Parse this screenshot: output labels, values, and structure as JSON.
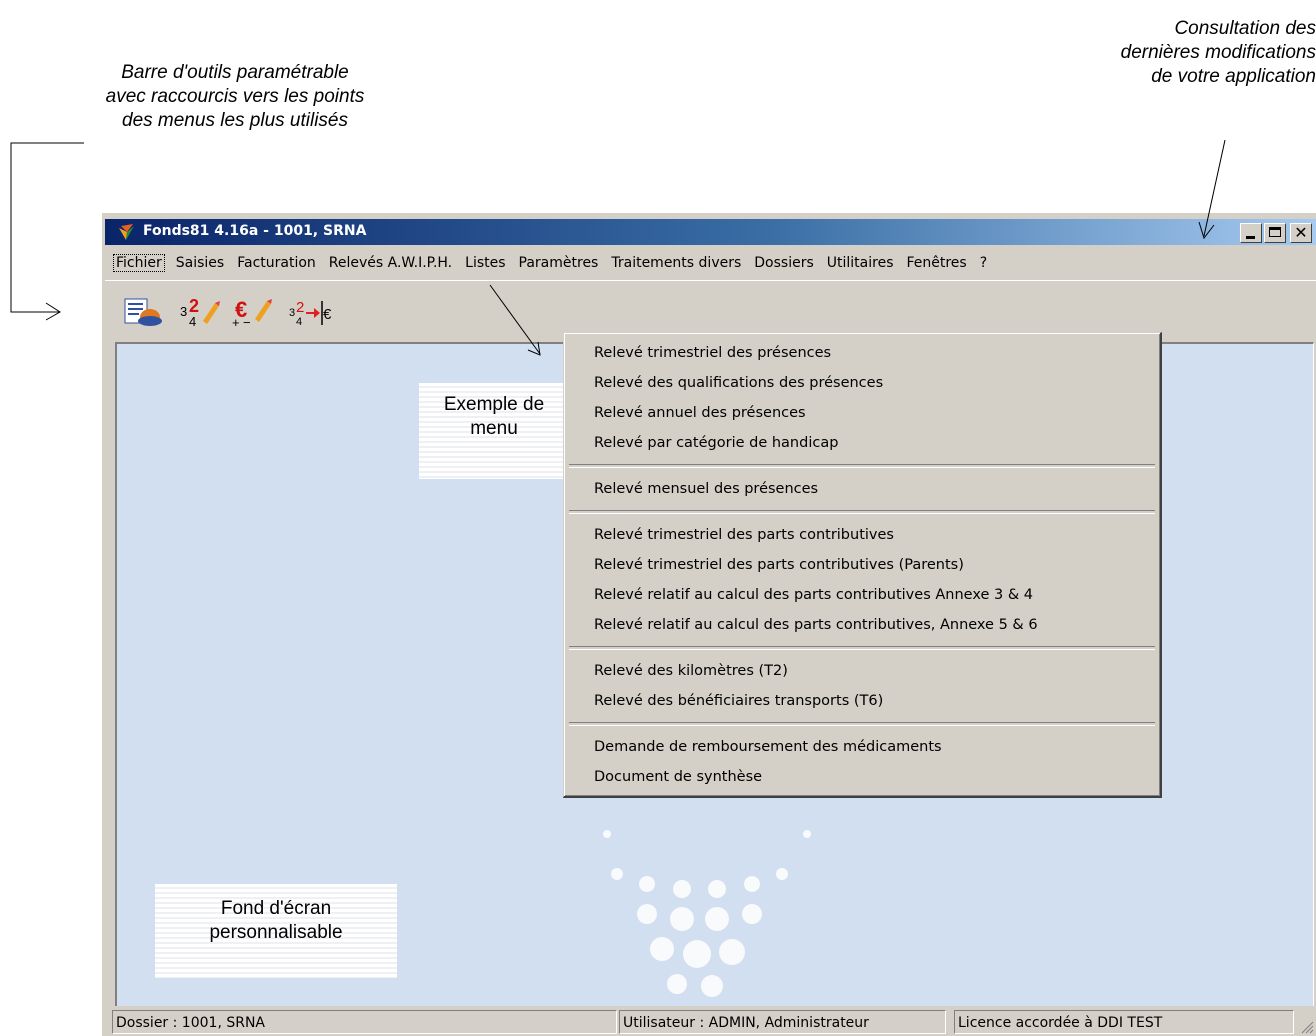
{
  "annotations": {
    "toolbar_note": "Barre d'outils paramétrable avec raccourcis vers les points des menus les plus utilisés",
    "changelog_note": "Consultation des dernières modifications de votre application",
    "menu_note": "Exemple de menu",
    "background_note": "Fond d'écran personnalisable"
  },
  "window": {
    "title": "Fonds81 4.16a - 1001, SRNA",
    "close_glyph": "✕"
  },
  "menubar": {
    "items": [
      "Fichier",
      "Saisies",
      "Facturation",
      "Relevés A.W.I.P.H.",
      "Listes",
      "Paramètres",
      "Traitements divers",
      "Dossiers",
      "Utilitaires",
      "Fenêtres",
      "?"
    ]
  },
  "toolbar": {
    "icons": [
      "list-search-icon",
      "fraction-edit-icon",
      "euro-plus-minus-icon",
      "fraction-to-euro-icon"
    ]
  },
  "dropdown": {
    "groups": [
      [
        "Relevé trimestriel des présences",
        "Relevé des qualifications des présences",
        "Relevé annuel des présences",
        "Relevé par catégorie de handicap"
      ],
      [
        "Relevé mensuel des présences"
      ],
      [
        "Relevé trimestriel des parts contributives",
        "Relevé trimestriel des parts contributives (Parents)",
        "Relevé relatif au calcul des parts contributives Annexe 3 & 4",
        "Relevé relatif au calcul des parts contributives, Annexe 5 & 6"
      ],
      [
        "Relevé des kilomètres (T2)",
        "Relevé des bénéficiaires transports (T6)"
      ],
      [
        "Demande de remboursement des médicaments",
        "Document de synthèse"
      ]
    ]
  },
  "statusbar": {
    "dossier": "Dossier : 1001, SRNA",
    "user": "Utilisateur : ADMIN, Administrateur",
    "license": "Licence accordée à DDI TEST"
  },
  "colors": {
    "title_start": "#0a246a",
    "title_end": "#a6caf0",
    "client_bg": "#d1dff0",
    "chrome": "#d4d0c8"
  }
}
